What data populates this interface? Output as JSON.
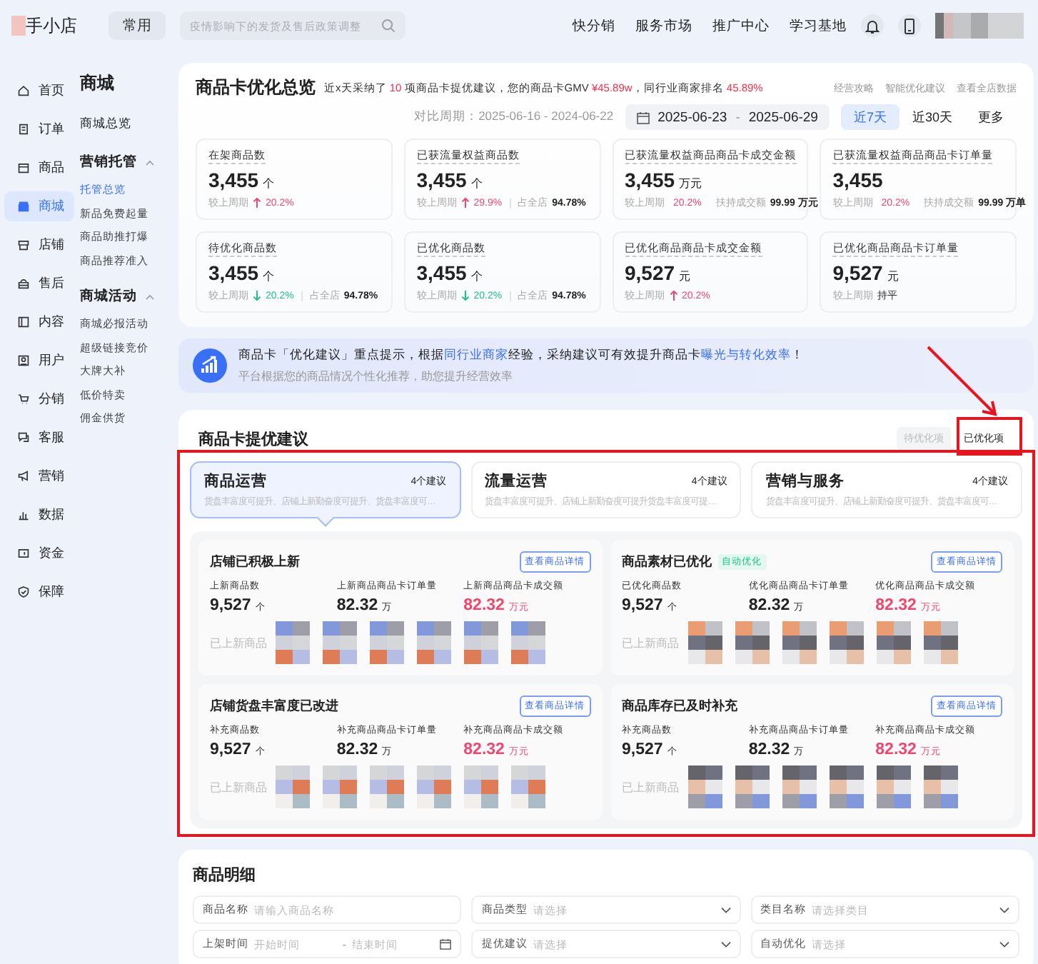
{
  "topbar": {
    "logo": "手小店",
    "common": "常用",
    "search": {
      "placeholder": "疫情影响下的发货及售后政策调整"
    },
    "links": [
      "快分销",
      "服务市场",
      "推广中心",
      "学习基地"
    ]
  },
  "sidebar": {
    "items": [
      {
        "label": "首页",
        "selected": false
      },
      {
        "label": "订单",
        "selected": false
      },
      {
        "label": "商品",
        "selected": false
      },
      {
        "label": "商城",
        "selected": true
      },
      {
        "label": "店铺",
        "selected": false
      },
      {
        "label": "售后",
        "selected": false
      },
      {
        "label": "内容",
        "selected": false
      },
      {
        "label": "用户",
        "selected": false
      },
      {
        "label": "分销",
        "selected": false
      },
      {
        "label": "客服",
        "selected": false
      },
      {
        "label": "营销",
        "selected": false
      },
      {
        "label": "数据",
        "selected": false
      },
      {
        "label": "资金",
        "selected": false
      },
      {
        "label": "保障",
        "selected": false
      }
    ]
  },
  "submenu": {
    "title": "商城",
    "top": {
      "label": "商城总览",
      "selected": false
    },
    "groups": [
      {
        "label": "营销托管",
        "expanded": true,
        "items": [
          {
            "label": "托管总览",
            "selected": true
          },
          {
            "label": "新品免费起量",
            "selected": false
          },
          {
            "label": "商品助推打爆",
            "selected": false
          },
          {
            "label": "商品推荐准入",
            "selected": false
          }
        ]
      },
      {
        "label": "商城活动",
        "expanded": true,
        "items": [
          {
            "label": "商城必报活动",
            "selected": false
          },
          {
            "label": "超级链接竞价",
            "selected": false
          },
          {
            "label": "大牌大补",
            "selected": false
          },
          {
            "label": "低价特卖",
            "selected": false
          },
          {
            "label": "佣金供货",
            "selected": false
          }
        ]
      }
    ]
  },
  "overview": {
    "title": "商品卡优化总览",
    "note": [
      {
        "text": "近x天采纳了 ",
        "highlight": false
      },
      {
        "text": "10",
        "highlight": true
      },
      {
        "text": " 项商品卡提优建议，您的商品卡GMV ",
        "highlight": false
      },
      {
        "text": "¥45.89w",
        "highlight": true
      },
      {
        "text": "，同行业商家排名 ",
        "highlight": false
      },
      {
        "text": "45.89%",
        "highlight": true
      }
    ],
    "links": [
      "经营攻略",
      "智能优化建议",
      "查看全店数据"
    ],
    "compare": "对比周期：2025-06-16 - 2024-06-22",
    "date_range": {
      "start": "2025-06-23",
      "separator": "-",
      "end": "2025-06-29"
    },
    "periods": [
      {
        "label": "近7天",
        "selected": true
      },
      {
        "label": "近30天",
        "selected": false
      },
      {
        "label": "更多",
        "selected": false
      }
    ],
    "metrics": [
      {
        "label": "在架商品数",
        "value": "3,455",
        "unit": "个",
        "change": {
          "label": "较上周期",
          "value": "20.2%",
          "kind": "up"
        }
      },
      {
        "label": "已获流量权益商品数",
        "value": "3,455",
        "unit": "个",
        "change": {
          "label": "较上周期",
          "value": "29.9%",
          "kind": "up"
        },
        "extra": {
          "label": "占全店",
          "value": "94.78%"
        }
      },
      {
        "label": "已获流量权益商品商品卡成交金额",
        "value": "3,455",
        "unit": "万元",
        "change": {
          "label": "较上周期",
          "value": "20.2%",
          "kind": "up"
        },
        "extra": {
          "label": "扶持成交额",
          "value": "99.99 万元"
        }
      },
      {
        "label": "已获流量权益商品商品卡订单量",
        "value": "3,455",
        "change": {
          "label": "较上周期",
          "value": "20.2%",
          "kind": "up"
        },
        "extra": {
          "label": "扶持成交额",
          "value": "99.99 万单"
        }
      },
      {
        "label": "待优化商品数",
        "value": "3,455",
        "unit": "个",
        "change": {
          "label": "较上周期",
          "value": "20.2%",
          "kind": "down"
        },
        "extra": {
          "label": "占全店",
          "value": "94.78%"
        }
      },
      {
        "label": "已优化商品数",
        "value": "3,455",
        "unit": "个",
        "change": {
          "label": "较上周期",
          "value": "20.2%",
          "kind": "down"
        },
        "extra": {
          "label": "占全店",
          "value": "94.78%"
        }
      },
      {
        "label": "已优化商品商品卡成交金额",
        "value": "9,527",
        "unit": "元",
        "change": {
          "label": "较上周期",
          "value": "20.2%",
          "kind": "up"
        }
      },
      {
        "label": "已优化商品商品卡订单量",
        "value": "9,527",
        "unit": "元",
        "change": {
          "label": "较上周期",
          "value": "持平",
          "kind": "flat"
        }
      }
    ]
  },
  "banner": {
    "title": [
      {
        "text": "商品卡「优化建议」重点提示，根据",
        "highlight": false
      },
      {
        "text": "同行业商家",
        "highlight": true
      },
      {
        "text": "经验，采纳建议可有效提升商品卡",
        "highlight": false
      },
      {
        "text": "曝光与转化效率",
        "highlight": true
      },
      {
        "text": "！",
        "highlight": false
      }
    ],
    "subtitle": "平台根据您的商品情况个性化推荐，助您提升经营效率"
  },
  "suggestions": {
    "title": "商品卡提优建议",
    "toggle": [
      {
        "label": "待优化项",
        "selected": false
      },
      {
        "label": "已优化项",
        "selected": true
      }
    ],
    "categories": [
      {
        "title": "商品运营",
        "count": "4个建议",
        "desc": "货盘丰富度可提升、店铺上新勤奋度可提升、货盘丰富度可…",
        "selected": true
      },
      {
        "title": "流量运营",
        "count": "4个建议",
        "desc": "货盘丰富度可提升、店铺上新勤奋度可提升货盘丰富度可提…",
        "selected": false
      },
      {
        "title": "营销与服务",
        "count": "4个建议",
        "desc": "货盘丰富度可提升、店铺上新勤奋度可提升、货盘丰富度可…",
        "selected": false
      }
    ],
    "results": [
      {
        "title": "店铺已积极上新",
        "button": "查看商品详情",
        "stats": [
          {
            "label": "上新商品数",
            "value": "9,527",
            "unit": "个",
            "highlight": false
          },
          {
            "label": "上新商品商品卡订单量",
            "value": "82.32",
            "unit": "万",
            "highlight": false
          },
          {
            "label": "上新商品商品卡成交额",
            "value": "82.32",
            "unit": "万元",
            "highlight": true
          }
        ],
        "images_label": "已上新商品"
      },
      {
        "title": "商品素材已优化",
        "tag": "自动优化",
        "button": "查看商品详情",
        "stats": [
          {
            "label": "已优化商品数",
            "value": "9,527",
            "unit": "个",
            "highlight": false
          },
          {
            "label": "优化商品商品卡订单量",
            "value": "82.32",
            "unit": "万",
            "highlight": false
          },
          {
            "label": "优化商品商品卡成交额",
            "value": "82.32",
            "unit": "万元",
            "highlight": true
          }
        ],
        "images_label": "已上新商品"
      },
      {
        "title": "店铺货盘丰富度已改进",
        "button": "查看商品详情",
        "stats": [
          {
            "label": "补充商品数",
            "value": "9,527",
            "unit": "个",
            "highlight": false
          },
          {
            "label": "补充商品商品卡订单量",
            "value": "82.32",
            "unit": "万",
            "highlight": false
          },
          {
            "label": "补充商品商品卡成交额",
            "value": "82.32",
            "unit": "万元",
            "highlight": true
          }
        ],
        "images_label": "已上新商品"
      },
      {
        "title": "商品库存已及时补充",
        "button": "查看商品详情",
        "stats": [
          {
            "label": "补充商品数",
            "value": "9,527",
            "unit": "个",
            "highlight": false
          },
          {
            "label": "补充商品商品卡订单量",
            "value": "82.32",
            "unit": "万",
            "highlight": false
          },
          {
            "label": "补充商品商品卡成交额",
            "value": "82.32",
            "unit": "万元",
            "highlight": true
          }
        ],
        "images_label": "已上新商品"
      }
    ]
  },
  "detail": {
    "title": "商品明细",
    "filters": [
      {
        "kind": "input",
        "label": "商品名称",
        "placeholder": "请输入商品名称"
      },
      {
        "kind": "select",
        "label": "商品类型",
        "placeholder": "请选择"
      },
      {
        "kind": "select",
        "label": "类目名称",
        "placeholder": "请选择类目"
      },
      {
        "kind": "daterange",
        "label": "上架时间",
        "placeholder": "开始时间",
        "separator": "-",
        "placeholder_end": "结束时间"
      },
      {
        "kind": "select",
        "label": "提优建议",
        "placeholder": "请选择"
      },
      {
        "kind": "select",
        "label": "自动优化",
        "placeholder": "请选择"
      }
    ]
  }
}
